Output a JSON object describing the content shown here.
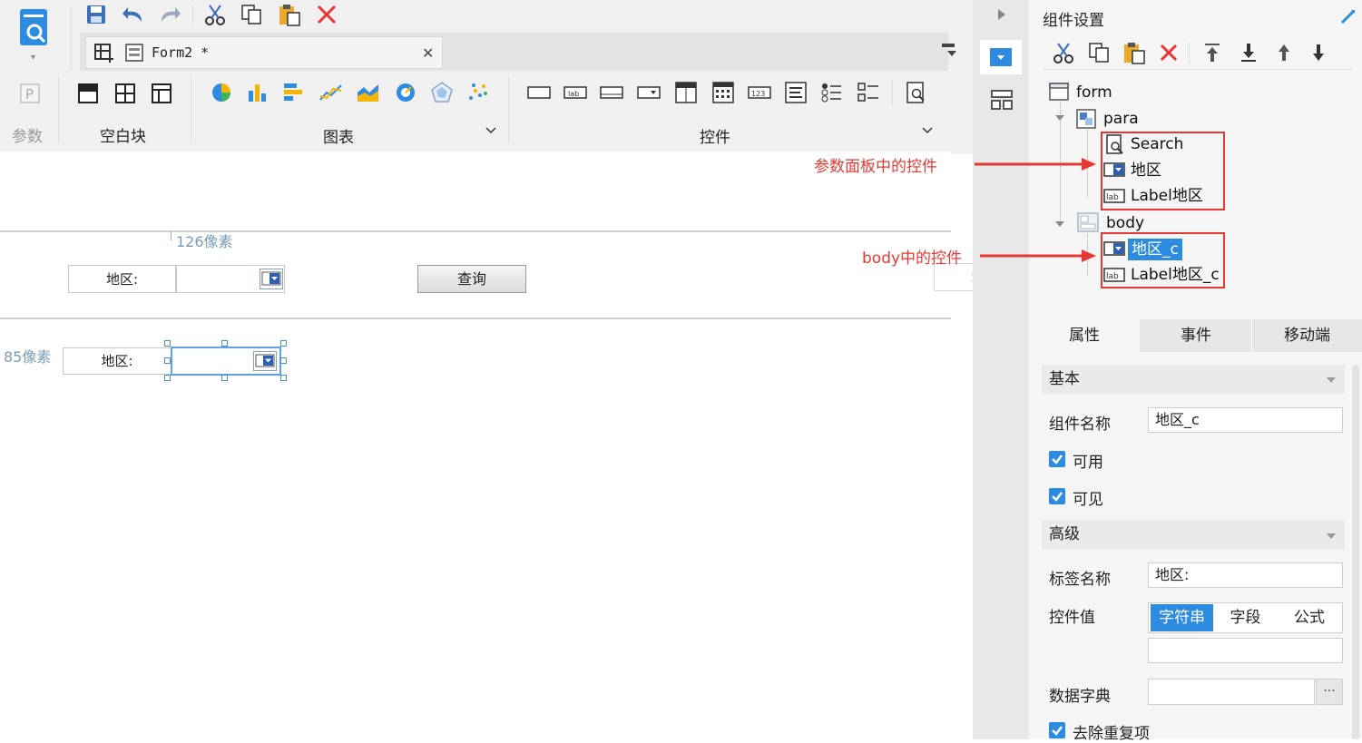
{
  "toolbar": {
    "document_tab": "Form2 *",
    "sections": {
      "param": "参数",
      "blank": "空白块",
      "chart": "图表",
      "widget": "控件"
    }
  },
  "canvas": {
    "note_126": "126像素",
    "note_85": "85像素",
    "para_label": "地区:",
    "query_button": "查询",
    "floating_label": "地区:",
    "body_label": "地区:"
  },
  "annotations": {
    "para_widgets": "参数面板中的控件",
    "body_widgets": "body中的控件"
  },
  "panel": {
    "title": "组件设置",
    "tree": {
      "form": "form",
      "para": "para",
      "search": "Search",
      "area": "地区",
      "label_area": "Label地区",
      "body": "body",
      "area_c": "地区_c",
      "label_area_c": "Label地区_c"
    },
    "tabs": [
      "属性",
      "事件",
      "移动端"
    ],
    "basic": {
      "heading": "基本",
      "name_label": "组件名称",
      "name_value": "地区_c",
      "enabled": "可用",
      "visible": "可见"
    },
    "advanced": {
      "heading": "高级",
      "tag_name_label": "标签名称",
      "tag_name_value": "地区:",
      "value_label": "控件值",
      "value_modes": [
        "字符串",
        "字段",
        "公式"
      ],
      "dict_label": "数据字典",
      "dict_button": "···",
      "dedupe": "去除重复项"
    },
    "accent_color": "#2d8be0"
  }
}
